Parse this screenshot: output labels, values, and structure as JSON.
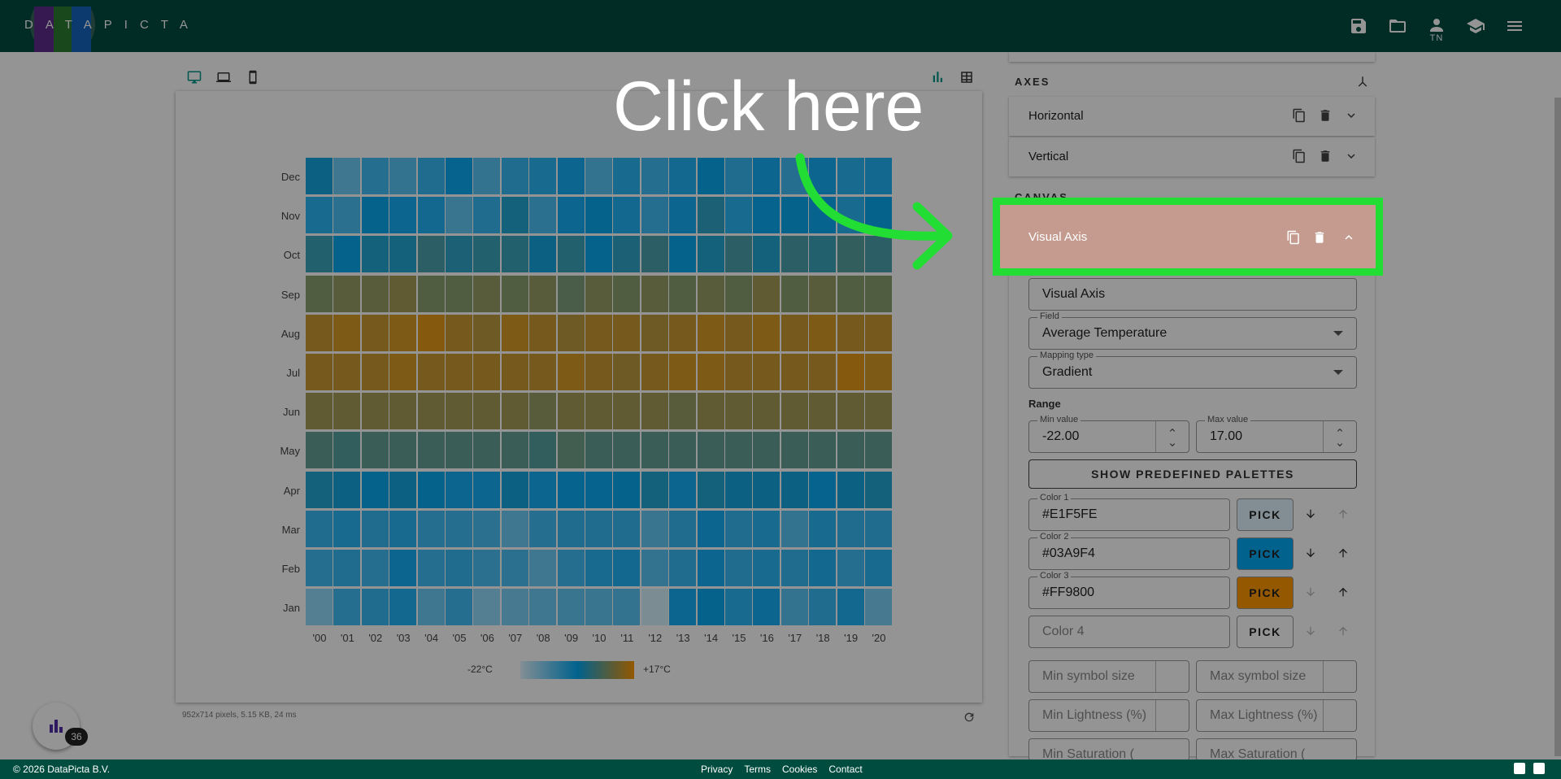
{
  "app": {
    "logo_text": "DATAPICTA"
  },
  "topbar": {
    "user_initials": "TN",
    "icons": [
      "save-icon",
      "folder-open-icon",
      "account-icon",
      "school-icon",
      "menu-icon"
    ]
  },
  "devices": [
    "desktop-icon",
    "laptop-icon",
    "phone-icon"
  ],
  "view_toggles": [
    "chart-view-icon",
    "table-view-icon"
  ],
  "chart": {
    "months": [
      "Dec",
      "Nov",
      "Oct",
      "Sep",
      "Aug",
      "Jul",
      "Jun",
      "May",
      "Apr",
      "Mar",
      "Feb",
      "Jan"
    ],
    "years": [
      "'00",
      "'01",
      "'02",
      "'03",
      "'04",
      "'05",
      "'06",
      "'07",
      "'08",
      "'09",
      "'10",
      "'11",
      "'12",
      "'13",
      "'14",
      "'15",
      "'16",
      "'17",
      "'18",
      "'19",
      "'20"
    ],
    "legend_min": "-22°C",
    "legend_max": "+17°C"
  },
  "chart_data": {
    "type": "heatmap",
    "x_categories": [
      "'00",
      "'01",
      "'02",
      "'03",
      "'04",
      "'05",
      "'06",
      "'07",
      "'08",
      "'09",
      "'10",
      "'11",
      "'12",
      "'13",
      "'14",
      "'15",
      "'16",
      "'17",
      "'18",
      "'19",
      "'20"
    ],
    "y_categories": [
      "Dec",
      "Nov",
      "Oct",
      "Sep",
      "Aug",
      "Jul",
      "Jun",
      "May",
      "Apr",
      "Mar",
      "Feb",
      "Jan"
    ],
    "color_field": "Average Temperature",
    "color_range": [
      -22,
      17
    ],
    "colors": [
      "#E1F5FE",
      "#03A9F4",
      "#FF9800"
    ],
    "values": [
      [
        -1,
        -12,
        -8,
        -10,
        -7,
        -3,
        -10,
        -7,
        -6,
        -4,
        -10,
        -6,
        -8,
        -5,
        -2,
        -7,
        -4,
        -8,
        -4,
        -6,
        -5
      ],
      [
        -6,
        -9,
        -2,
        -4,
        -5,
        -11,
        -7,
        0,
        -9,
        -4,
        -2,
        -5,
        -8,
        -4,
        1,
        -6,
        -3,
        -2,
        -3,
        -6,
        -2
      ],
      [
        2,
        -2,
        0,
        0,
        3,
        1,
        2,
        2,
        -1,
        2,
        -2,
        1,
        3,
        -2,
        0,
        3,
        0,
        3,
        2,
        4,
        3
      ],
      [
        8,
        9,
        9,
        10,
        8,
        8,
        9,
        8,
        9,
        7,
        9,
        8,
        9,
        8,
        9,
        8,
        10,
        8,
        9,
        8,
        8
      ],
      [
        13,
        14,
        13,
        14,
        15,
        13,
        12,
        14,
        13,
        12,
        13,
        13,
        12,
        13,
        14,
        13,
        14,
        13,
        14,
        13,
        13
      ],
      [
        13,
        13,
        13,
        14,
        13,
        13,
        13,
        13,
        13,
        14,
        13,
        12,
        13,
        14,
        14,
        13,
        13,
        13,
        13,
        15,
        14
      ],
      [
        10,
        10,
        10,
        10,
        10,
        10,
        10,
        10,
        9,
        10,
        10,
        10,
        10,
        9,
        10,
        10,
        10,
        10,
        10,
        10,
        10
      ],
      [
        5,
        4,
        5,
        5,
        5,
        5,
        5,
        5,
        4,
        6,
        5,
        5,
        5,
        5,
        5,
        5,
        5,
        5,
        5,
        5,
        5
      ],
      [
        0,
        -1,
        -2,
        -1,
        -2,
        -4,
        -4,
        -1,
        -4,
        -3,
        -3,
        -2,
        0,
        -4,
        0,
        -1,
        -1,
        -1,
        -3,
        -1,
        0
      ],
      [
        -7,
        -6,
        -7,
        -6,
        -8,
        -8,
        -9,
        -12,
        -8,
        -7,
        -7,
        -7,
        -11,
        -7,
        -4,
        -7,
        -6,
        -10,
        -6,
        -7,
        -7
      ],
      [
        -8,
        -7,
        -8,
        -4,
        -8,
        -7,
        -9,
        -9,
        -12,
        -8,
        -6,
        -5,
        -10,
        -7,
        -4,
        -7,
        -6,
        -7,
        -5,
        -8,
        -6
      ],
      [
        -15,
        -8,
        -7,
        -5,
        -12,
        -8,
        -15,
        -13,
        -12,
        -11,
        -11,
        -10,
        -21,
        -4,
        -2,
        -6,
        -4,
        -10,
        -7,
        -5,
        -13
      ]
    ]
  },
  "status": "952x714 pixels, 5.15 KB, 24 ms",
  "fab_badge": "36",
  "panel": {
    "axes_title": "AXES",
    "canvas_title": "CANVAS",
    "horizontal": "Horizontal",
    "vertical": "Vertical",
    "visual_axis": "Visual Axis",
    "name_value": "Visual Axis",
    "field_label": "Field",
    "field_value": "Average Temperature",
    "mapping_label": "Mapping type",
    "mapping_value": "Gradient",
    "range_label": "Range",
    "min_label": "Min value",
    "min_value": "-22.00",
    "max_label": "Max value",
    "max_value": "17.00",
    "palettes_button": "SHOW PREDEFINED PALETTES",
    "colors": [
      {
        "label": "Color 1",
        "value": "#E1F5FE",
        "swatch": "#E1F5FE"
      },
      {
        "label": "Color 2",
        "value": "#03A9F4",
        "swatch": "#03A9F4"
      },
      {
        "label": "Color 3",
        "value": "#FF9800",
        "swatch": "#FF9800"
      },
      {
        "label": "",
        "value": "Color 4",
        "swatch": "#ffffff"
      }
    ],
    "pick": "PICK",
    "min_symbol": "Min symbol size",
    "max_symbol": "Max symbol size",
    "min_light": "Min Lightness (%)",
    "max_light": "Max Lightness (%)",
    "min_sat": "Min Saturation (",
    "max_sat": "Max Saturation ("
  },
  "tutorial": {
    "text": "Click here",
    "highlight_color": "#22dd33"
  },
  "footer": {
    "copyright": "© 2026 DataPicta B.V.",
    "links": [
      "Privacy",
      "Terms",
      "Cookies",
      "Contact"
    ]
  }
}
